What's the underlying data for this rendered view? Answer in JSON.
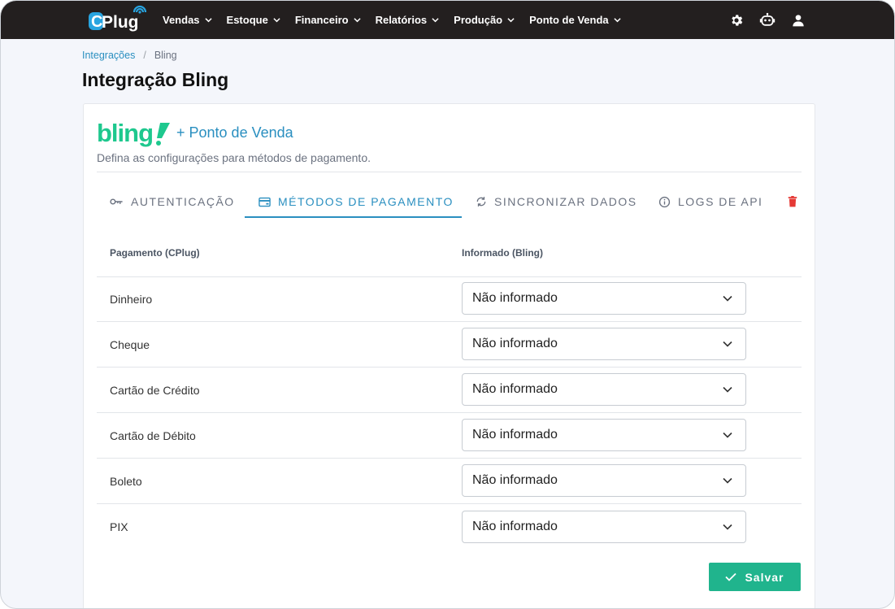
{
  "brand": {
    "logo_text": "CPlug",
    "colors": {
      "navbar": "#231f1f",
      "accent": "#2a8fc0",
      "bling": "#1ec88e",
      "success": "#20b48d",
      "danger": "#e53935"
    }
  },
  "nav": {
    "menu": [
      {
        "label": "Vendas"
      },
      {
        "label": "Estoque"
      },
      {
        "label": "Financeiro"
      },
      {
        "label": "Relatórios"
      },
      {
        "label": "Produção"
      },
      {
        "label": "Ponto de Venda"
      }
    ],
    "icons": [
      "gear-icon",
      "robot-icon",
      "user-icon"
    ]
  },
  "breadcrumb": {
    "parent": "Integrações",
    "separator": "/",
    "current": "Bling"
  },
  "page": {
    "title": "Integração Bling"
  },
  "card": {
    "logo_text": "bling!",
    "heading": "+ Ponto de Venda",
    "description": "Defina as configurações para métodos de pagamento."
  },
  "tabs": [
    {
      "label": "AUTENTICAÇÃO",
      "icon": "key-icon",
      "active": false
    },
    {
      "label": "MÉTODOS DE PAGAMENTO",
      "icon": "credit-card-icon",
      "active": true
    },
    {
      "label": "SINCRONIZAR DADOS",
      "icon": "sync-icon",
      "active": false
    },
    {
      "label": "LOGS DE API",
      "icon": "info-icon",
      "active": false
    }
  ],
  "table": {
    "headers": [
      "Pagamento (CPlug)",
      "Informado (Bling)"
    ],
    "rows": [
      {
        "payment": "Dinheiro",
        "value": "Não informado"
      },
      {
        "payment": "Cheque",
        "value": "Não informado"
      },
      {
        "payment": "Cartão de Crédito",
        "value": "Não informado"
      },
      {
        "payment": "Cartão de Débito",
        "value": "Não informado"
      },
      {
        "payment": "Boleto",
        "value": "Não informado"
      },
      {
        "payment": "PIX",
        "value": "Não informado"
      }
    ]
  },
  "actions": {
    "save_label": "Salvar"
  }
}
